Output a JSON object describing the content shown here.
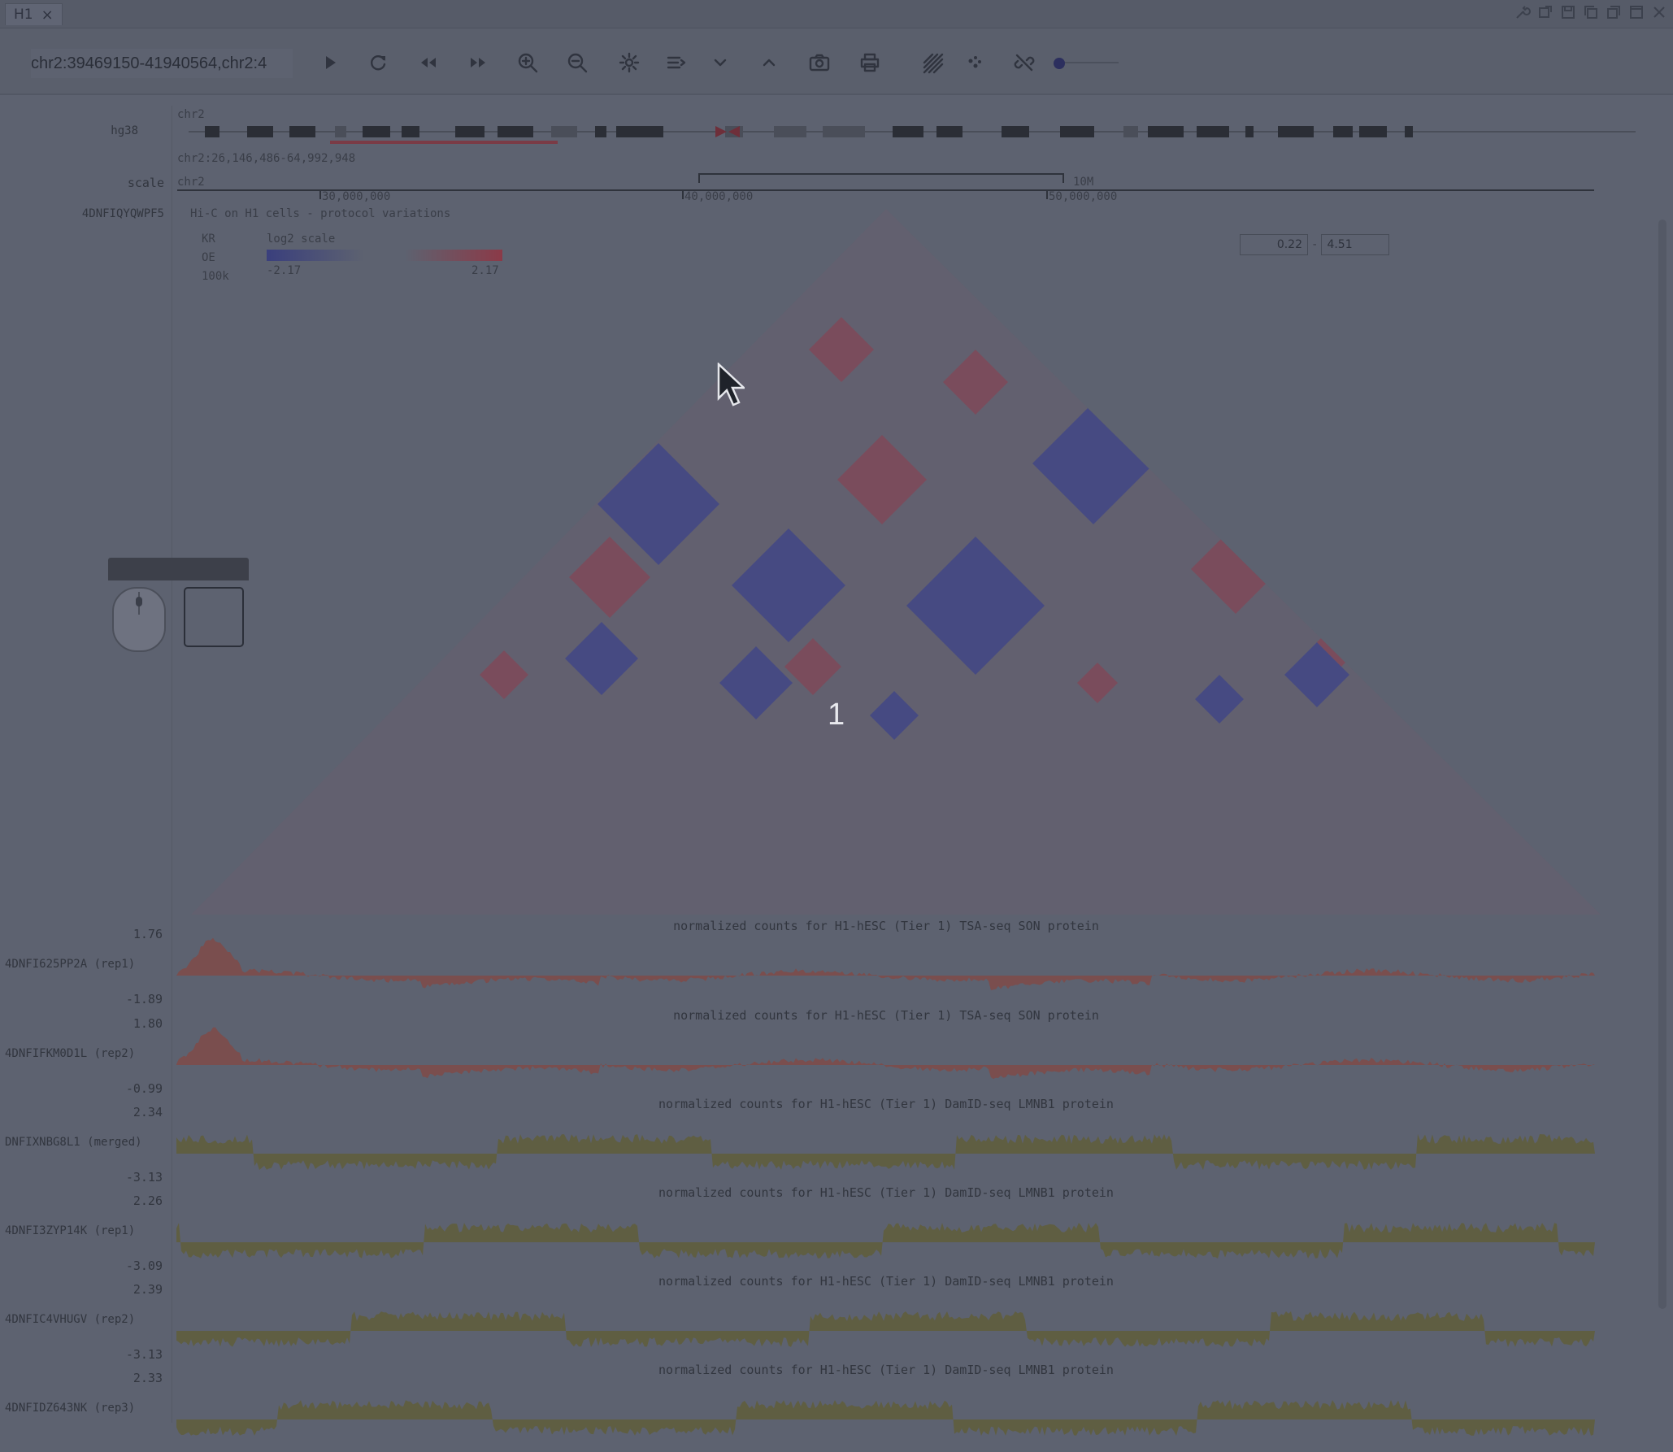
{
  "window": {
    "tab_title": "H1",
    "tab_close": "×"
  },
  "toolbar": {
    "location": "chr2:39469150-41940564,chr2:4",
    "buttons": [
      "play",
      "refresh",
      "rewind",
      "fast-forward",
      "zoom-in",
      "zoom-out",
      "settings",
      "menu-lines",
      "chevron-down",
      "chevron-up",
      "camera",
      "print",
      "hatch",
      "scatter-dots",
      "unlink"
    ]
  },
  "tracks": {
    "ideogram": {
      "label": "hg38",
      "chrom": "chr2",
      "range": "chr2:26,146,486-64,992,948"
    },
    "scale": {
      "label": "scale",
      "chrom": "chr2",
      "bar_label": "10M",
      "ticks": [
        "30,000,000",
        "40,000,000",
        "50,000,000"
      ]
    },
    "hic": {
      "id": "4DNFIQYQWPF5",
      "title": "Hi-C on H1 cells - protocol variations",
      "norm": "KR",
      "mode": "OE",
      "resolution": "100k",
      "scale_label": "log2 scale",
      "legend_min": "-2.17",
      "legend_max": "2.17",
      "range_min": "0.22",
      "range_sep": "-",
      "range_max": "4.51"
    },
    "signal": [
      {
        "name": "4DNFI625PP2A (rep1)",
        "title": "normalized counts for H1-hESC (Tier 1) TSA-seq SON protein",
        "max": "1.76",
        "min": "-1.89",
        "color": "#7d4c4a"
      },
      {
        "name": "4DNFIFKM0D1L (rep2)",
        "title": "normalized counts for H1-hESC (Tier 1) TSA-seq SON protein",
        "max": "1.80",
        "min": "-0.99",
        "color": "#7d4c4a"
      },
      {
        "name": "DNFIXNBG8L1 (merged)",
        "title": "normalized counts for H1-hESC (Tier 1) DamID-seq LMNB1 protein",
        "max": "2.34",
        "min": "-3.13",
        "color": "#5f5e3d"
      },
      {
        "name": "4DNFI3ZYP14K (rep1)",
        "title": "normalized counts for H1-hESC (Tier 1) DamID-seq LMNB1 protein",
        "max": "2.26",
        "min": "-3.09",
        "color": "#5f5e3d"
      },
      {
        "name": "4DNFIC4VHUGV (rep2)",
        "title": "normalized counts for H1-hESC (Tier 1) DamID-seq LMNB1 protein",
        "max": "2.39",
        "min": "-3.13",
        "color": "#5f5e3d"
      },
      {
        "name": "4DNFIDZ643NK (rep3)",
        "title": "normalized counts for H1-hESC (Tier 1) DamID-seq LMNB1 protein",
        "max": "2.33",
        "min": "",
        "color": "#5f5e3d"
      }
    ]
  },
  "overlay": {
    "step_number": "1"
  },
  "colors": {
    "hic_blue": "#3e4388",
    "hic_red": "#8e3d4c"
  }
}
